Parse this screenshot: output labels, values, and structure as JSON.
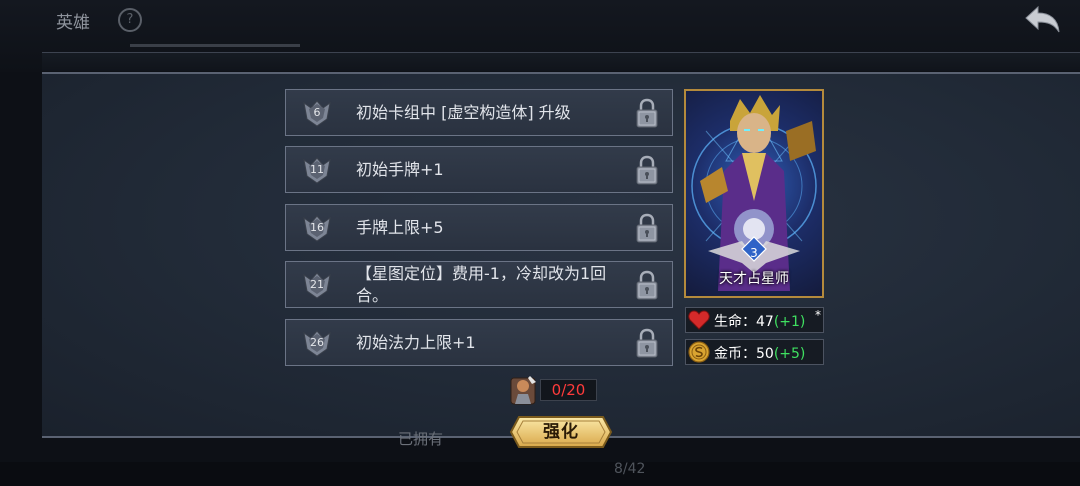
{
  "background": {
    "title": "英雄",
    "help_glyph": "?",
    "owned_label": "已拥有",
    "page_indicator": "8/42"
  },
  "skills": [
    {
      "level": "6",
      "text": "初始卡组中 [虚空构造体] 升级",
      "locked": true
    },
    {
      "level": "11",
      "text": "初始手牌+1",
      "locked": true
    },
    {
      "level": "16",
      "text": "手牌上限+5",
      "locked": true
    },
    {
      "level": "21",
      "text": "【星图定位】费用-1，冷却改为1回合。",
      "locked": true
    },
    {
      "level": "26",
      "text": "初始法力上限+1",
      "locked": true
    }
  ],
  "hero": {
    "name": "天才占星师",
    "level": "3"
  },
  "stats": {
    "hp_label": "生命：",
    "hp_value": "47",
    "hp_bonus": "(+1)",
    "hp_mark": "*",
    "gold_label": "金币：",
    "gold_value": "50",
    "gold_bonus": "(+5)"
  },
  "resource": {
    "count": "0/20"
  },
  "upgrade_button": "强化",
  "colors": {
    "accent_gold": "#b48a3c",
    "bonus_green": "#3fe060",
    "resource_red": "#ff3b3b"
  },
  "icons": [
    "back-arrow-icon",
    "level-shield-icon",
    "lock-icon",
    "heart-icon",
    "coin-icon",
    "hero-token-icon"
  ]
}
